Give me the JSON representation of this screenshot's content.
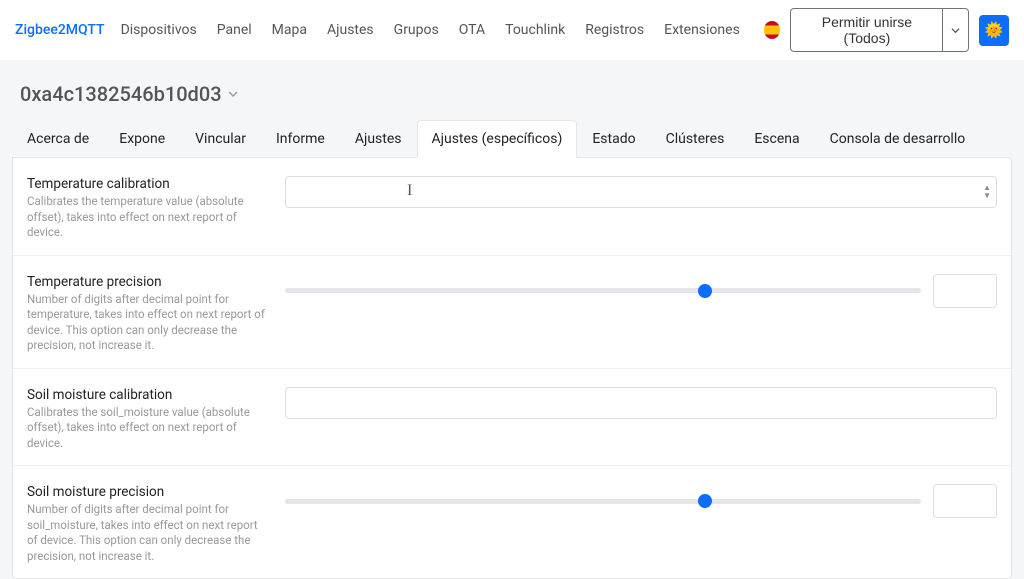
{
  "navbar": {
    "brand": "Zigbee2MQTT",
    "items": [
      "Dispositivos",
      "Panel",
      "Mapa",
      "Ajustes",
      "Grupos",
      "OTA",
      "Touchlink",
      "Registros",
      "Extensiones"
    ],
    "permit_label": "Permitir unirse (Todos)",
    "theme_emoji": "🌞"
  },
  "device": {
    "title": "0xa4c1382546b10d03"
  },
  "tabs": [
    "Acerca de",
    "Expone",
    "Vincular",
    "Informe",
    "Ajustes",
    "Ajustes (específicos)",
    "Estado",
    "Clústeres",
    "Escena",
    "Consola de desarrollo"
  ],
  "activeTabIndex": 5,
  "settings": [
    {
      "name": "Temperature calibration",
      "desc": "Calibrates the temperature value (absolute offset), takes into effect on next report of device.",
      "type": "number",
      "value": "",
      "show_cursor": true
    },
    {
      "name": "Temperature precision",
      "desc": "Number of digits after decimal point for temperature, takes into effect on next report of device. This option can only decrease the precision, not increase it.",
      "type": "slider",
      "pos": 66
    },
    {
      "name": "Soil moisture calibration",
      "desc": "Calibrates the soil_moisture value (absolute offset), takes into effect on next report of device.",
      "type": "number",
      "value": ""
    },
    {
      "name": "Soil moisture precision",
      "desc": "Number of digits after decimal point for soil_moisture, takes into effect on next report of device. This option can only decrease the precision, not increase it.",
      "type": "slider",
      "pos": 66
    }
  ]
}
